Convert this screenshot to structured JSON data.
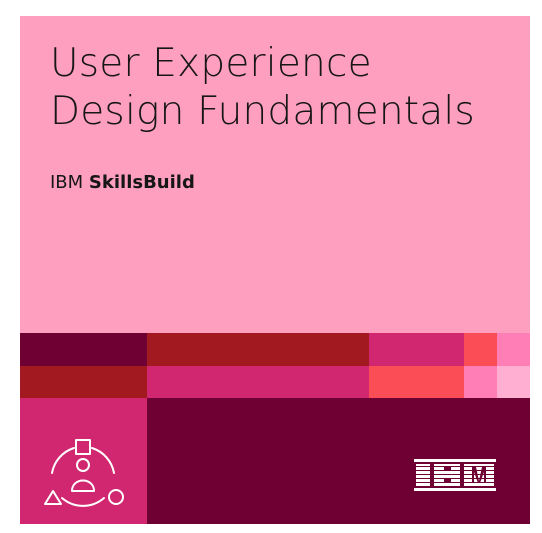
{
  "badge": {
    "title_line1": "User Experience",
    "title_line2": "Design Fundamentals",
    "brand_prefix": "IBM",
    "brand_name": "SkillsBuild"
  },
  "icons": {
    "badge_icon": "user-shapes-icon",
    "logo": "ibm-logo"
  },
  "colors": {
    "pink_background": "#ff9fc0",
    "deep_maroon": "#6f0033",
    "red": "#a2191f",
    "magenta": "#d12771",
    "coral": "#fa4d56",
    "light_pink": "#ff7eb6",
    "pale_pink": "#ffafd2"
  }
}
